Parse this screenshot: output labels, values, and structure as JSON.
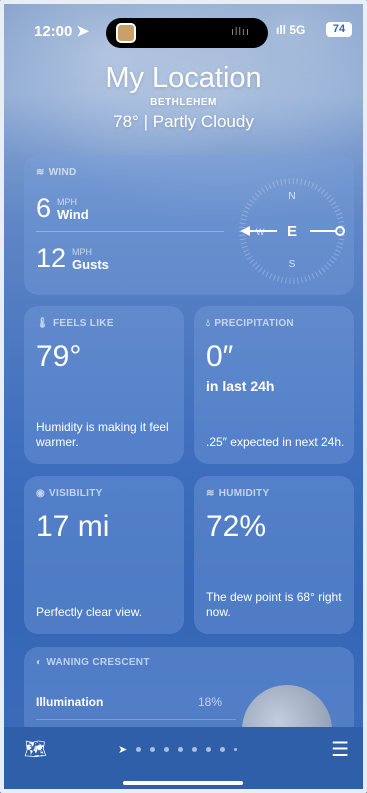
{
  "status_bar": {
    "time": "12:00",
    "signal": "5G",
    "battery": "74"
  },
  "header": {
    "location": "My Location",
    "city": "BETHLEHEM",
    "temp": "78°",
    "condition": "Partly Cloudy"
  },
  "wind": {
    "label": "WIND",
    "wind_value": "6",
    "wind_unit": "MPH",
    "wind_label": "Wind",
    "gust_value": "12",
    "gust_unit": "MPH",
    "gust_label": "Gusts",
    "compass": {
      "n": "N",
      "e": "E",
      "s": "S",
      "w": "W"
    }
  },
  "feels_like": {
    "label": "FEELS LIKE",
    "value": "79°",
    "note": "Humidity is making it feel warmer."
  },
  "precipitation": {
    "label": "PRECIPITATION",
    "value": "0″",
    "sub": "in last 24h",
    "note": ".25″ expected in next 24h."
  },
  "visibility": {
    "label": "VISIBILITY",
    "value": "17 mi",
    "note": "Perfectly clear view."
  },
  "humidity": {
    "label": "HUMIDITY",
    "value": "72%",
    "note": "The dew point is 68° right now."
  },
  "moon": {
    "label": "WANING CRESCENT",
    "illumination_label": "Illumination",
    "illumination_value": "18%"
  },
  "colors": {
    "card": "#6f9ad6",
    "background": "#3f6fbe",
    "toolbar": "#2f5fa9"
  },
  "icons": [
    "location-arrow-icon",
    "signal-icon",
    "wind-icon",
    "thermometer-icon",
    "drop-icon",
    "eye-icon",
    "humidity-icon",
    "moon-icon",
    "map-icon",
    "list-icon"
  ]
}
